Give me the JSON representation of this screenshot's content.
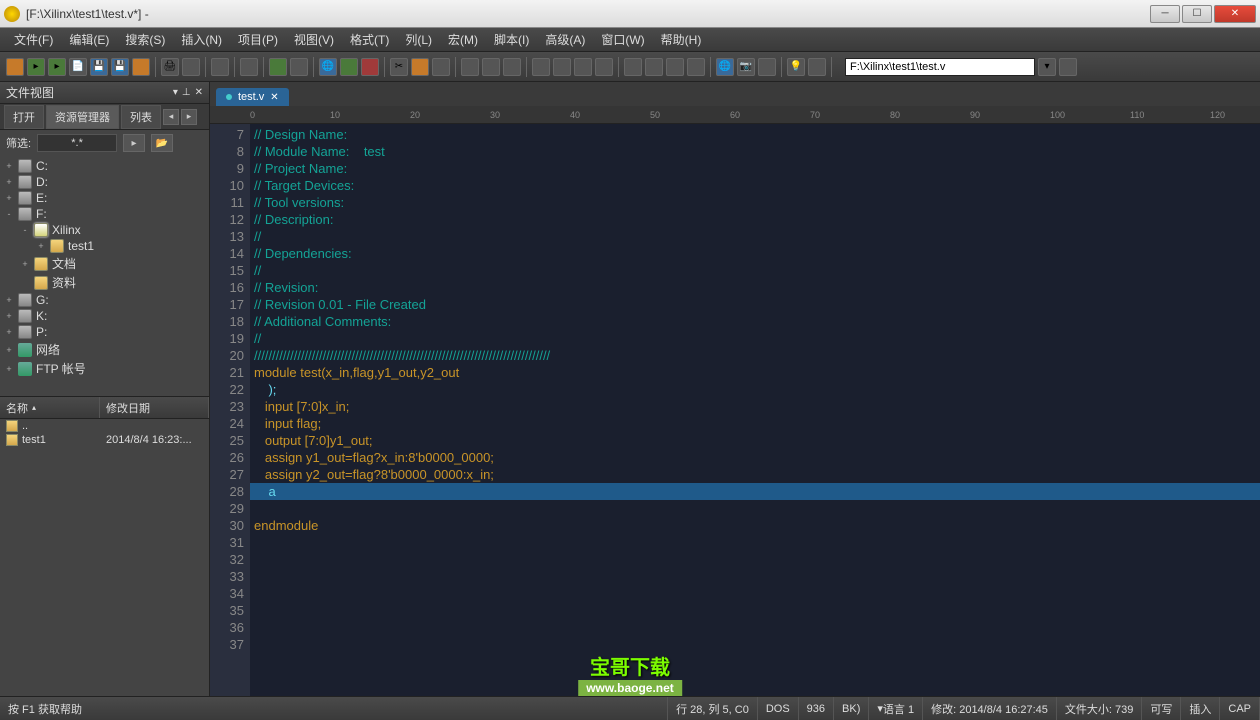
{
  "window": {
    "title": "[F:\\Xilinx\\test1\\test.v*] -"
  },
  "menu": [
    "文件(F)",
    "编辑(E)",
    "搜索(S)",
    "插入(N)",
    "项目(P)",
    "视图(V)",
    "格式(T)",
    "列(L)",
    "宏(M)",
    "脚本(I)",
    "高级(A)",
    "窗口(W)",
    "帮助(H)"
  ],
  "path_field": "F:\\Xilinx\\test1\\test.v",
  "sidebar": {
    "title": "文件视图",
    "tabs": [
      "打开",
      "资源管理器",
      "列表"
    ],
    "filter_label": "筛选:",
    "filter_value": "*.*",
    "tree": [
      {
        "indent": 0,
        "exp": "+",
        "icon": "drive",
        "label": "C:"
      },
      {
        "indent": 0,
        "exp": "+",
        "icon": "drive",
        "label": "D:"
      },
      {
        "indent": 0,
        "exp": "+",
        "icon": "drive",
        "label": "E:"
      },
      {
        "indent": 0,
        "exp": "-",
        "icon": "drive",
        "label": "F:"
      },
      {
        "indent": 1,
        "exp": "-",
        "icon": "foldsel",
        "label": "Xilinx"
      },
      {
        "indent": 2,
        "exp": "+",
        "icon": "fold",
        "label": "test1"
      },
      {
        "indent": 1,
        "exp": "+",
        "icon": "fold",
        "label": "文档"
      },
      {
        "indent": 1,
        "exp": "",
        "icon": "fold",
        "label": "资料"
      },
      {
        "indent": 0,
        "exp": "+",
        "icon": "drive",
        "label": "G:"
      },
      {
        "indent": 0,
        "exp": "+",
        "icon": "drive",
        "label": "K:"
      },
      {
        "indent": 0,
        "exp": "+",
        "icon": "drive",
        "label": "P:"
      },
      {
        "indent": 0,
        "exp": "+",
        "icon": "net",
        "label": "网络"
      },
      {
        "indent": 0,
        "exp": "+",
        "icon": "net",
        "label": "FTP 帐号"
      }
    ],
    "list_hdr": [
      "名称",
      "修改日期"
    ],
    "list": [
      {
        "name": "..",
        "date": ""
      },
      {
        "name": "test1",
        "date": "2014/8/4 16:23:..."
      }
    ]
  },
  "editor_tab": "test.v",
  "ruler": [
    0,
    10,
    20,
    30,
    40,
    50,
    60,
    70,
    80,
    90,
    100,
    110,
    120
  ],
  "code_start": 7,
  "code": [
    {
      "t": "// Design Name:",
      "c": "comment"
    },
    {
      "t": "// Module Name:    test",
      "c": "comment"
    },
    {
      "t": "// Project Name:",
      "c": "comment"
    },
    {
      "t": "// Target Devices:",
      "c": "comment"
    },
    {
      "t": "// Tool versions:",
      "c": "comment"
    },
    {
      "t": "// Description:",
      "c": "comment"
    },
    {
      "t": "//",
      "c": "comment"
    },
    {
      "t": "// Dependencies:",
      "c": "comment"
    },
    {
      "t": "//",
      "c": "comment"
    },
    {
      "t": "// Revision:",
      "c": "comment"
    },
    {
      "t": "// Revision 0.01 - File Created",
      "c": "comment"
    },
    {
      "t": "// Additional Comments:",
      "c": "comment"
    },
    {
      "t": "//",
      "c": "comment"
    },
    {
      "t": "//////////////////////////////////////////////////////////////////////////////////",
      "c": "comment"
    },
    {
      "t": "module test(x_in,flag,y1_out,y2_out",
      "c": "kw"
    },
    {
      "t": "    );",
      "c": ""
    },
    {
      "t": "   input [7:0]x_in;",
      "c": "kw"
    },
    {
      "t": "   input flag;",
      "c": "kw"
    },
    {
      "t": "   output [7:0]y1_out;",
      "c": "kw"
    },
    {
      "t": "   assign y1_out=flag?x_in:8'b0000_0000;",
      "c": "kw"
    },
    {
      "t": "   assign y2_out=flag?8'b0000_0000:x_in;",
      "c": "kw"
    },
    {
      "t": "    a",
      "c": "",
      "hl": true
    },
    {
      "t": "",
      "c": ""
    },
    {
      "t": "endmodule",
      "c": "kw"
    },
    {
      "t": "",
      "c": ""
    },
    {
      "t": "",
      "c": ""
    },
    {
      "t": "",
      "c": ""
    },
    {
      "t": "",
      "c": ""
    },
    {
      "t": "",
      "c": ""
    },
    {
      "t": "",
      "c": ""
    },
    {
      "t": "",
      "c": ""
    }
  ],
  "status": {
    "help": "按 F1 获取帮助",
    "pos": "行 28, 列 5, C0",
    "dos": "DOS",
    "cp": "936",
    "enc": "BK)",
    "lang": "语言 1",
    "mod": "修改: 2014/8/4 16:27:45",
    "size": "文件大小: 739",
    "rw": "可写",
    "ins": "插入",
    "cap": "CAP"
  },
  "watermark": {
    "t1": "宝哥下载",
    "t2": "www.baoge.net"
  }
}
